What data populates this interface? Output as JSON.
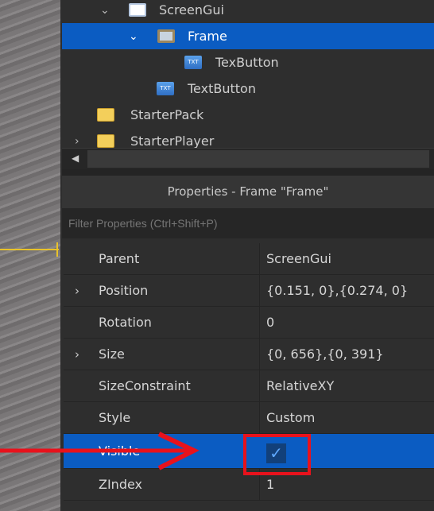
{
  "explorer": {
    "items": [
      {
        "label": "ScreenGui",
        "icon": "screengui-icon",
        "expanded": true
      },
      {
        "label": "Frame",
        "icon": "frame-icon",
        "expanded": true,
        "selected": true
      },
      {
        "label": "TexButton",
        "icon": "textbutton-icon"
      },
      {
        "label": "TextButton",
        "icon": "textbutton-icon"
      },
      {
        "label": "StarterPack",
        "icon": "starterpack-icon"
      },
      {
        "label": "StarterPlayer",
        "icon": "starterplayer-icon",
        "expanded": false
      }
    ],
    "button_icon_text": "TXT"
  },
  "properties": {
    "title": "Properties - Frame \"Frame\"",
    "filter_placeholder": "Filter Properties (Ctrl+Shift+P)",
    "rows": [
      {
        "name": "Parent",
        "value": "ScreenGui"
      },
      {
        "name": "Position",
        "value": "{0.151, 0},{0.274, 0}",
        "expandable": true
      },
      {
        "name": "Rotation",
        "value": "0"
      },
      {
        "name": "Size",
        "value": "{0, 656},{0, 391}",
        "expandable": true
      },
      {
        "name": "SizeConstraint",
        "value": "RelativeXY"
      },
      {
        "name": "Style",
        "value": "Custom"
      },
      {
        "name": "Visible",
        "value": true,
        "selected": true
      },
      {
        "name": "ZIndex",
        "value": "1"
      }
    ]
  },
  "colors": {
    "selection": "#0b5cc2",
    "annotation": "#e8121c"
  }
}
